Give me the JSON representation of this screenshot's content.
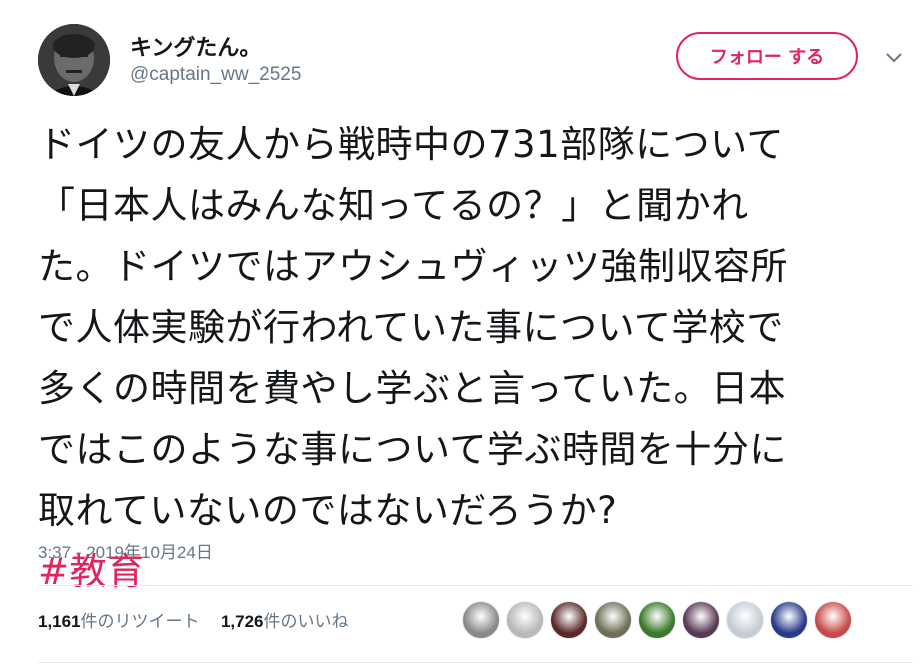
{
  "user": {
    "display_name": "キングたん。",
    "handle": "@captain_ww_2525"
  },
  "follow_button": {
    "label": "フォロー する"
  },
  "tweet": {
    "lines": [
      "ドイツの友人から戦時中の731部隊について",
      "「日本人はみんな知ってるの？」と聞かれ",
      "た。ドイツではアウシュヴィッツ強制収容所",
      "で人体実験が行われていた事について学校で",
      "多くの時間を費やし学ぶと言っていた。日本",
      "ではこのような事について学ぶ時間を十分に",
      "取れていないのではないだろうか?"
    ],
    "hashtag": "#教育",
    "timestamp": "3:37 - 2019年10月24日"
  },
  "stats": {
    "retweets_count": "1,161",
    "retweets_label": "件のリツイート",
    "likes_count": "1,726",
    "likes_label": "件のいいね"
  },
  "colors": {
    "accent": "#e0245e",
    "secondary_text": "#657786",
    "divider": "#e6ecf0"
  },
  "likers": [
    {
      "name": "liker-avatar-1",
      "color": "#8a8a8a"
    },
    {
      "name": "liker-avatar-2",
      "color": "#b8b8b8"
    },
    {
      "name": "liker-avatar-3",
      "color": "#5a2a2a"
    },
    {
      "name": "liker-avatar-4",
      "color": "#6f6f55"
    },
    {
      "name": "liker-avatar-5",
      "color": "#3a7a2a"
    },
    {
      "name": "liker-avatar-6",
      "color": "#5a3a55"
    },
    {
      "name": "liker-avatar-7",
      "color": "#c5ccd3"
    },
    {
      "name": "liker-avatar-8",
      "color": "#2a3a8a"
    },
    {
      "name": "liker-avatar-9",
      "color": "#c84a4a"
    }
  ]
}
